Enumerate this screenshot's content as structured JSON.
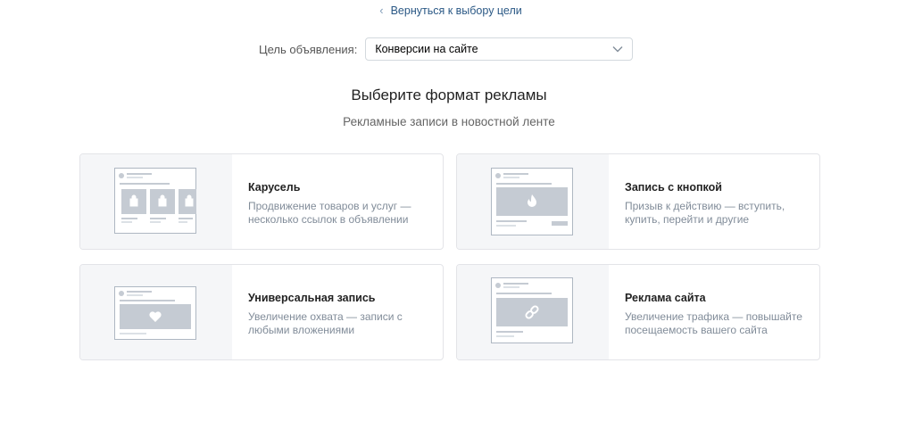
{
  "back_link": {
    "label": "Вернуться к выбору цели"
  },
  "goal": {
    "label": "Цель объявления:",
    "selected": "Конверсии на сайте"
  },
  "heading": {
    "title": "Выберите формат рекламы",
    "subtitle": "Рекламные записи в новостной ленте"
  },
  "formats": [
    {
      "name": "Карусель",
      "desc1": "Продвижение товаров и услуг —",
      "desc2": "несколько ссылок в объявлении"
    },
    {
      "name": "Запись с кнопкой",
      "desc1": "Призыв к действию — вступить,",
      "desc2": "купить, перейти и другие"
    },
    {
      "name": "Универсальная запись",
      "desc1": "Увеличение охвата — записи с",
      "desc2": "любыми вложениями"
    },
    {
      "name": "Реклама сайта",
      "desc1": "Увеличение трафика — повышайте",
      "desc2": "посещаемость вашего сайта"
    }
  ],
  "colors": {
    "link": "#2a5885",
    "muted": "#818c99",
    "border": "#e3e4e8",
    "thumb_bg": "#f5f6f8"
  }
}
